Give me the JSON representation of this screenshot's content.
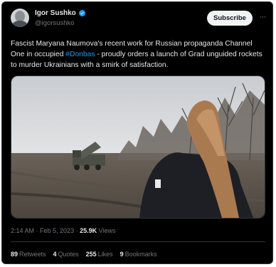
{
  "author": {
    "display_name": "Igor Sushko",
    "handle": "@igorsushko",
    "verified_icon": "verified-badge-icon",
    "avatar_icon": "user-avatar"
  },
  "header": {
    "subscribe_label": "Subscribe",
    "more_icon": "more-options-icon"
  },
  "tweet": {
    "text_before": "Fascist Maryana Naumova's recent work for Russian propaganda Channel One in occupied ",
    "hashtag": "#Donbas",
    "text_after": " - proudly orders a launch of Grad unguided rockets to murder Ukrainians with a smirk of satisfaction."
  },
  "meta": {
    "time": "2:14 AM",
    "separator": " · ",
    "date": "Feb 5, 2023",
    "views_count": "25.9K",
    "views_label": "Views"
  },
  "stats": [
    {
      "count": "89",
      "label": "Retweets"
    },
    {
      "count": "4",
      "label": "Quotes"
    },
    {
      "count": "255",
      "label": "Likes"
    },
    {
      "count": "9",
      "label": "Bookmarks"
    }
  ],
  "colors": {
    "background": "#000000",
    "text": "#e7e9ea",
    "muted": "#71767b",
    "accent": "#1d9bf0",
    "border": "#2f3336"
  }
}
